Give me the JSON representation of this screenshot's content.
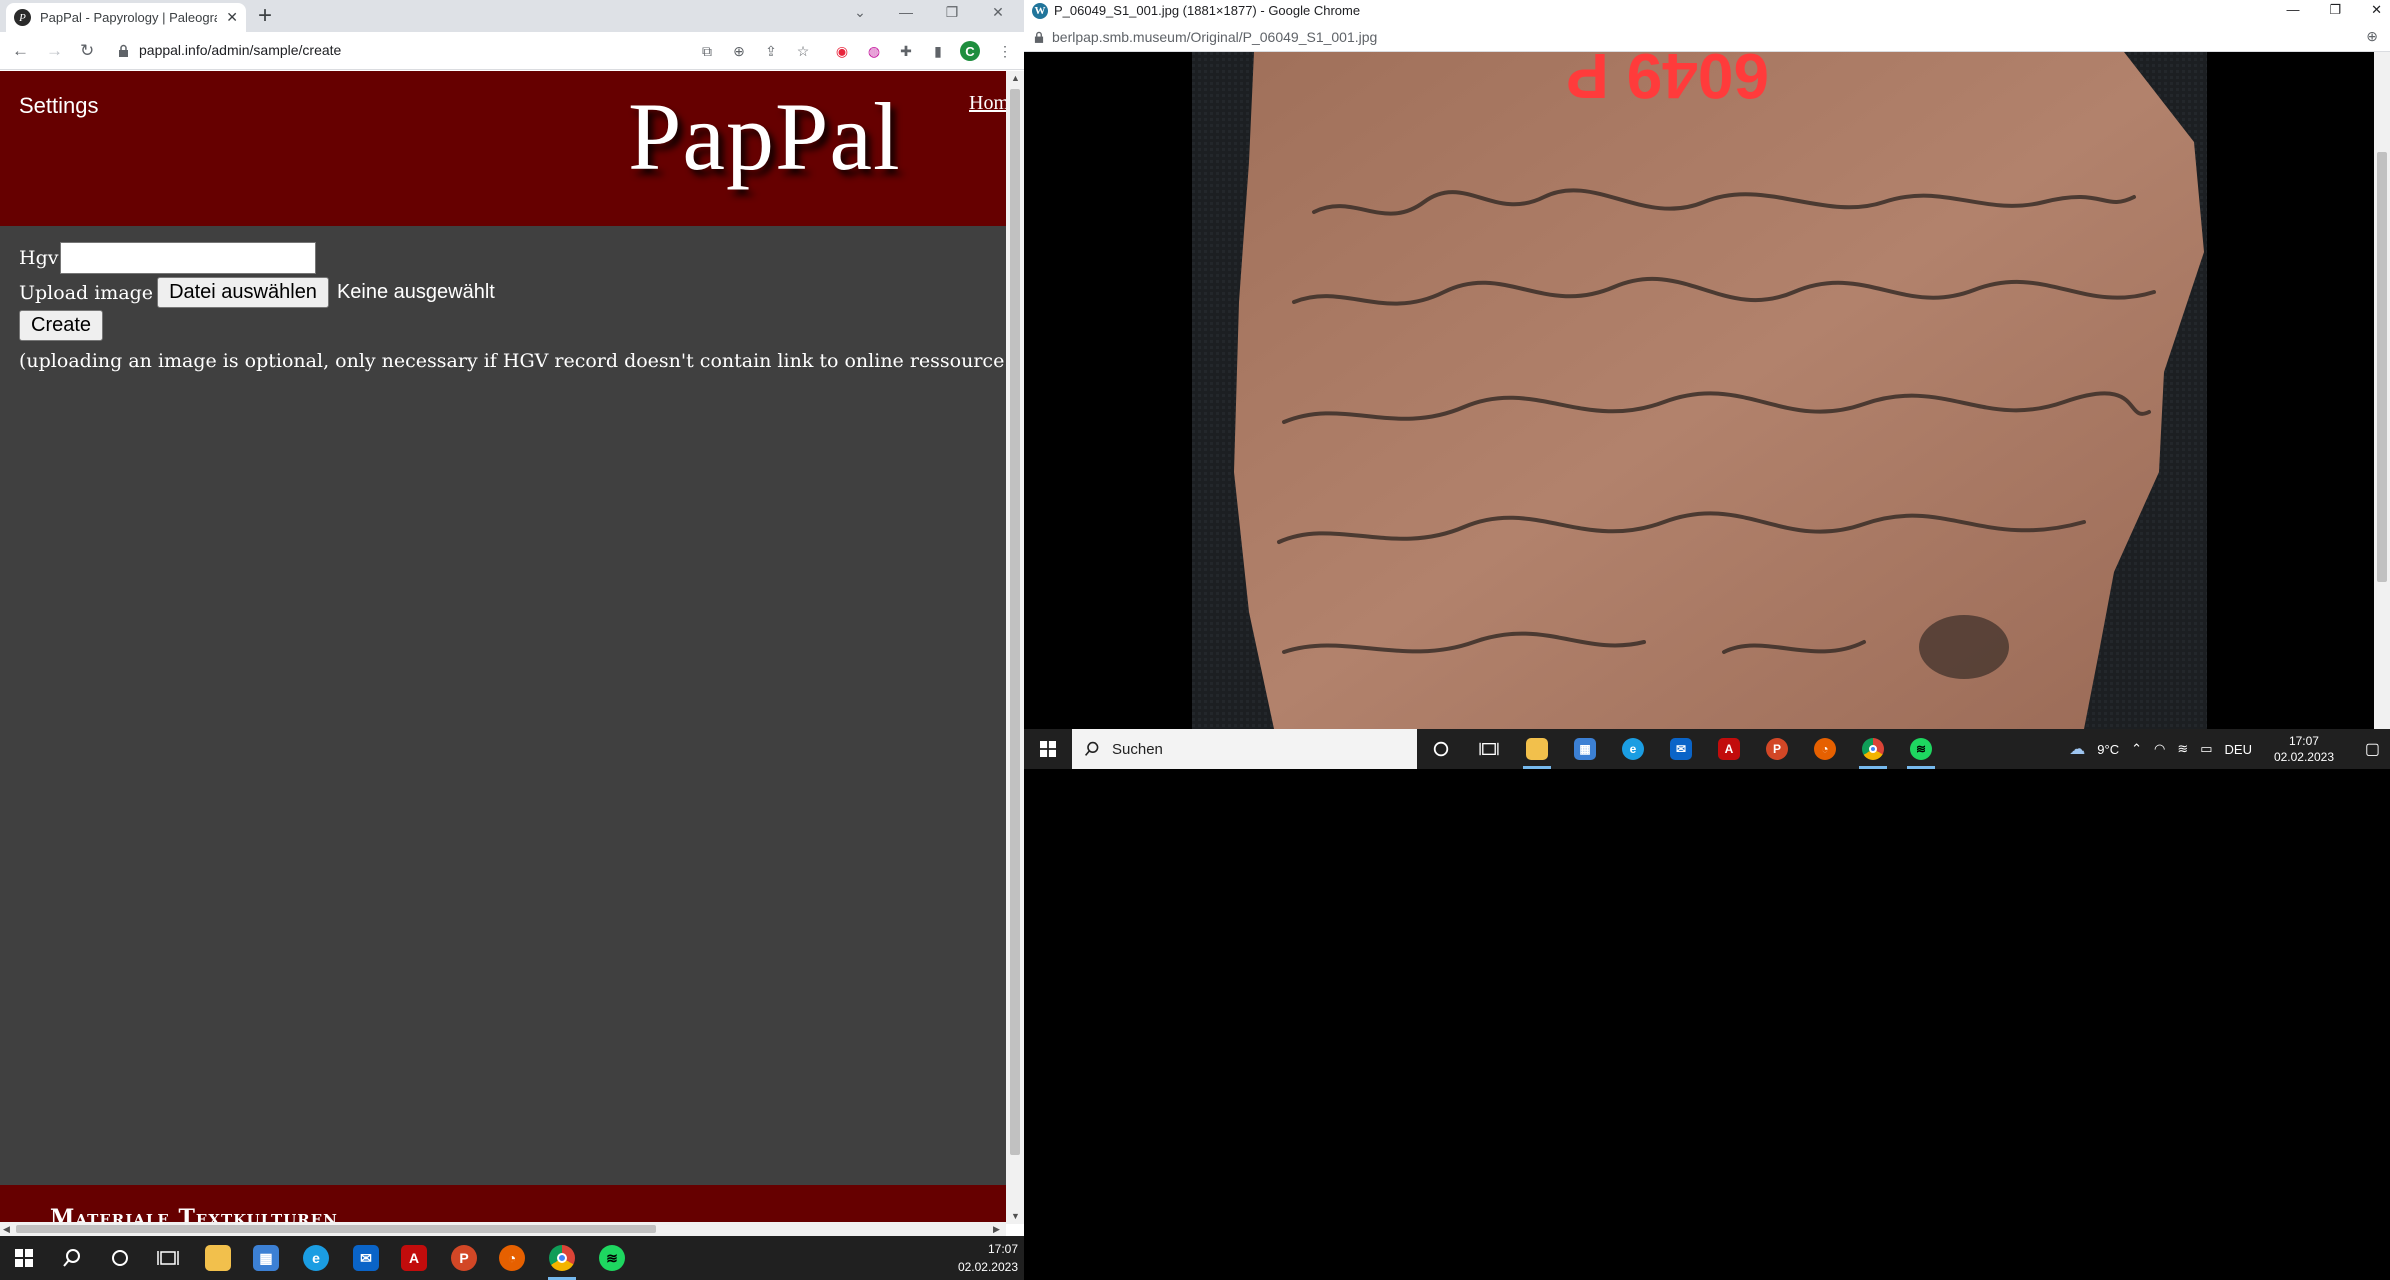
{
  "left_browser": {
    "tab_title": "PapPal - Papyrology | Paleography",
    "tab_close": "✕",
    "new_tab": "+",
    "url": "pappal.info/admin/sample/create",
    "profile_initial": "C"
  },
  "site": {
    "settings_label": "Settings",
    "logo": "PapPal",
    "home_link": "Home",
    "form": {
      "hgv_label": "Hgv",
      "hgv_value": "",
      "upload_label": "Upload image",
      "file_button": "Datei auswählen",
      "file_status": "Keine ausgewählt",
      "create_button": "Create",
      "hint": "(uploading an image is optional, only necessary if HGV record doesn't contain link to online ressource or if online archive is not supported)"
    },
    "footer_text": "Materiale Textkulturen",
    "header_color": "#660000",
    "body_color": "#404040"
  },
  "left_taskbar": {
    "time": "17:07",
    "date": "02.02.2023"
  },
  "right_browser": {
    "window_title": "P_06049_S1_001.jpg (1881×1877) - Google Chrome",
    "url": "berlpap.smb.museum/Original/P_06049_S1_001.jpg",
    "image_label": "6049 P"
  },
  "right_taskbar": {
    "search_placeholder": "Suchen",
    "weather": "9°C",
    "language": "DEU",
    "time": "17:07",
    "date": "02.02.2023"
  },
  "icons": [
    "windows-start-icon",
    "search-icon",
    "cortana-icon",
    "task-view-icon",
    "file-explorer-icon",
    "store-icon",
    "edge-icon",
    "mail-icon",
    "acrobat-icon",
    "powerpoint-icon",
    "firefox-icon",
    "chrome-icon",
    "spotify-icon"
  ]
}
